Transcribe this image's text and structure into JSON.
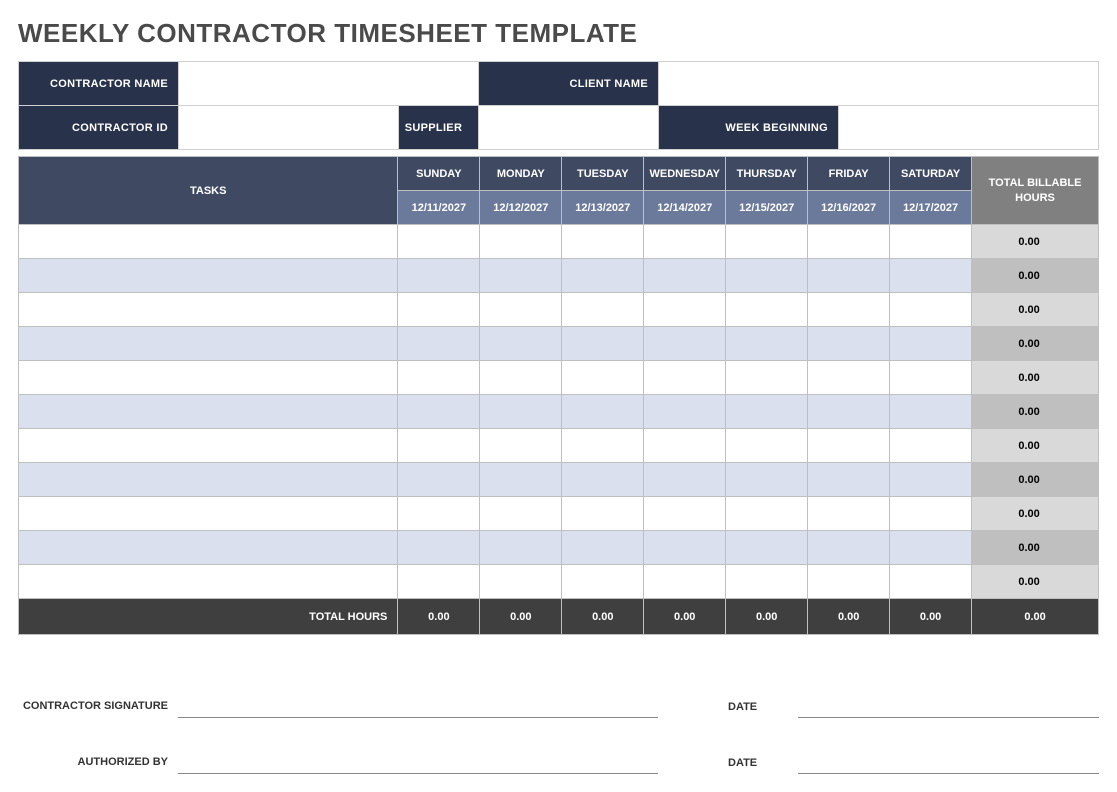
{
  "title": "WEEKLY CONTRACTOR TIMESHEET TEMPLATE",
  "info": {
    "contractor_name_label": "CONTRACTOR NAME",
    "client_name_label": "CLIENT NAME",
    "contractor_id_label": "CONTRACTOR ID",
    "supplier_label": "SUPPLIER",
    "week_beginning_label": "WEEK BEGINNING"
  },
  "headers": {
    "tasks": "TASKS",
    "total_billable": "TOTAL BILLABLE HOURS",
    "total_hours": "TOTAL HOURS"
  },
  "days": [
    {
      "name": "SUNDAY",
      "date": "12/11/2027",
      "total": "0.00"
    },
    {
      "name": "MONDAY",
      "date": "12/12/2027",
      "total": "0.00"
    },
    {
      "name": "TUESDAY",
      "date": "12/13/2027",
      "total": "0.00"
    },
    {
      "name": "WEDNESDAY",
      "date": "12/14/2027",
      "total": "0.00"
    },
    {
      "name": "THURSDAY",
      "date": "12/15/2027",
      "total": "0.00"
    },
    {
      "name": "FRIDAY",
      "date": "12/16/2027",
      "total": "0.00"
    },
    {
      "name": "SATURDAY",
      "date": "12/17/2027",
      "total": "0.00"
    }
  ],
  "rows": [
    {
      "total": "0.00"
    },
    {
      "total": "0.00"
    },
    {
      "total": "0.00"
    },
    {
      "total": "0.00"
    },
    {
      "total": "0.00"
    },
    {
      "total": "0.00"
    },
    {
      "total": "0.00"
    },
    {
      "total": "0.00"
    },
    {
      "total": "0.00"
    },
    {
      "total": "0.00"
    },
    {
      "total": "0.00"
    }
  ],
  "grand_total": "0.00",
  "signatures": {
    "contractor_signature": "CONTRACTOR SIGNATURE",
    "authorized_by": "AUTHORIZED BY",
    "date": "DATE"
  }
}
